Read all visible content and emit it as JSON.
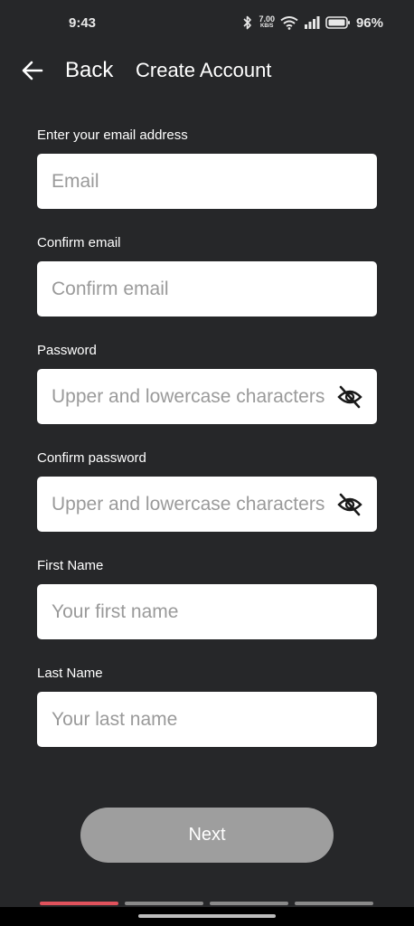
{
  "status_bar": {
    "time": "9:43",
    "net_speed_value": "7.00",
    "net_speed_unit": "KB/S",
    "battery_percent": "96%",
    "icons": [
      "bluetooth-icon",
      "wifi-icon",
      "signal-icon",
      "battery-icon"
    ]
  },
  "header": {
    "back_label": "Back",
    "title": "Create Account"
  },
  "form": {
    "fields": [
      {
        "label": "Enter your email address",
        "placeholder": "Email",
        "value": ""
      },
      {
        "label": "Confirm email",
        "placeholder": "Confirm email",
        "value": ""
      },
      {
        "label": "Password",
        "placeholder": "Upper and lowercase characters",
        "value": ""
      },
      {
        "label": "Confirm password",
        "placeholder": "Upper and lowercase characters",
        "value": ""
      },
      {
        "label": "First Name",
        "placeholder": "Your first name",
        "value": ""
      },
      {
        "label": "Last Name",
        "placeholder": "Your last name",
        "value": ""
      }
    ]
  },
  "next_button": {
    "label": "Next"
  },
  "progress": {
    "total_steps": 4,
    "current_step": 1,
    "active_color": "#e0525c",
    "inactive_color": "#8a8a8a"
  },
  "colors": {
    "background": "#262729",
    "input_background": "#ffffff",
    "button_disabled": "#9e9e9e"
  }
}
